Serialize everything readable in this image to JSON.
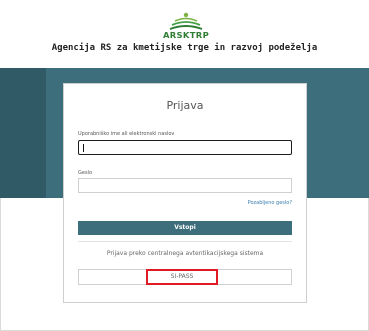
{
  "header": {
    "logo_text": "ARSKTRP",
    "agency_title": "Agencija RS za kmetijske trge in razvoj podeželja"
  },
  "login": {
    "title": "Prijava",
    "username_label": "Uporabniško ime ali elektronski naslov",
    "username_value": "",
    "password_label": "Geslo",
    "password_value": "",
    "forgot_password": "Pozabljeno geslo?",
    "submit_label": "Vstopi",
    "central_auth_text": "Prijava preko centralnega avtentikacijskega sistema",
    "sipass_label": "SI-PASS"
  },
  "colors": {
    "band": "#3d6e7c",
    "button": "#3d6e7c",
    "link": "#3a7fb0",
    "logo": "#2e7d32",
    "highlight": "#e01b24"
  },
  "icons": {
    "logo": "arsktrp-logo-icon"
  }
}
